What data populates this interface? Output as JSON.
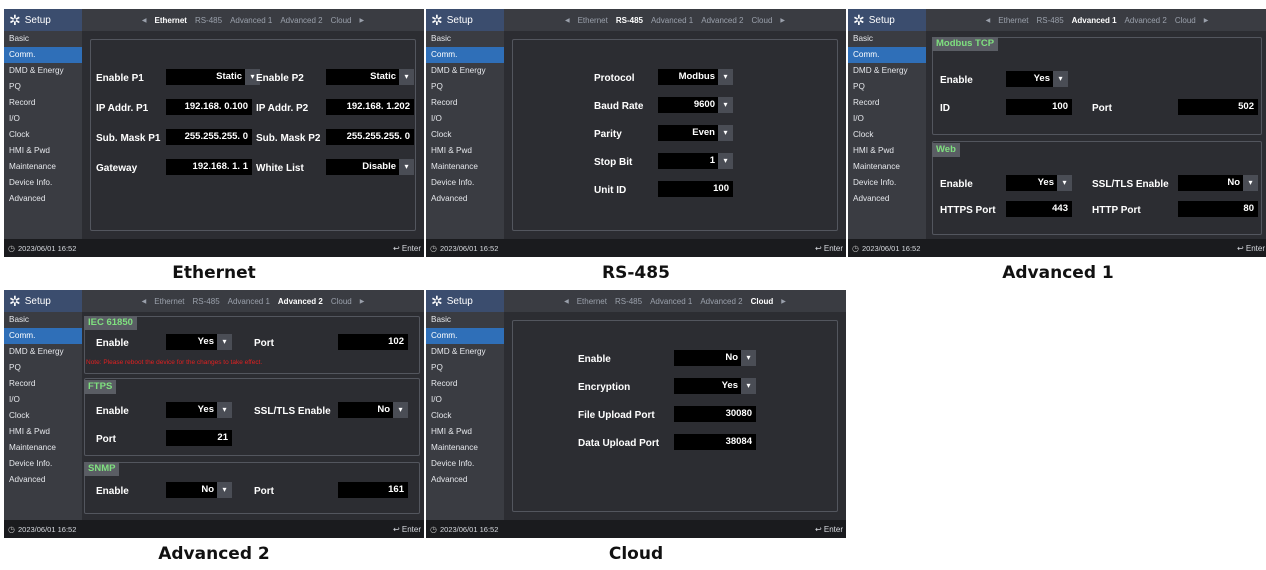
{
  "setup_label": "Setup",
  "tabs": [
    "Ethernet",
    "RS-485",
    "Advanced 1",
    "Advanced 2",
    "Cloud"
  ],
  "sidebar": [
    "Basic",
    "Comm.",
    "DMD & Energy",
    "PQ",
    "Record",
    "I/O",
    "Clock",
    "HMI & Pwd",
    "Maintenance",
    "Device Info.",
    "Advanced"
  ],
  "status": {
    "datetime": "2023/06/01 16:52",
    "enter": "Enter"
  },
  "captions": {
    "ethernet": "Ethernet",
    "rs485": "RS-485",
    "advanced1": "Advanced 1",
    "advanced2": "Advanced 2",
    "cloud": "Cloud"
  },
  "ethernet": {
    "enable_p1": {
      "label": "Enable P1",
      "value": "Static"
    },
    "enable_p2": {
      "label": "Enable P2",
      "value": "Static"
    },
    "ip_p1": {
      "label": "IP Addr. P1",
      "value": "192.168.  0.100"
    },
    "ip_p2": {
      "label": "IP Addr. P2",
      "value": "192.168.  1.202"
    },
    "mask_p1": {
      "label": "Sub. Mask P1",
      "value": "255.255.255.  0"
    },
    "mask_p2": {
      "label": "Sub. Mask P2",
      "value": "255.255.255.  0"
    },
    "gateway": {
      "label": "Gateway",
      "value": "192.168.  1.  1"
    },
    "white_list": {
      "label": "White List",
      "value": "Disable"
    }
  },
  "rs485": {
    "protocol": {
      "label": "Protocol",
      "value": "Modbus"
    },
    "baud": {
      "label": "Baud Rate",
      "value": "9600"
    },
    "parity": {
      "label": "Parity",
      "value": "Even"
    },
    "stop": {
      "label": "Stop Bit",
      "value": "1"
    },
    "unit": {
      "label": "Unit ID",
      "value": "100"
    }
  },
  "advanced1": {
    "modbus_title": "Modbus TCP",
    "mb_enable": {
      "label": "Enable",
      "value": "Yes"
    },
    "mb_id": {
      "label": "ID",
      "value": "100"
    },
    "mb_port": {
      "label": "Port",
      "value": "502"
    },
    "web_title": "Web",
    "web_enable": {
      "label": "Enable",
      "value": "Yes"
    },
    "web_ssl": {
      "label": "SSL/TLS Enable",
      "value": "No"
    },
    "https": {
      "label": "HTTPS Port",
      "value": "443"
    },
    "http": {
      "label": "HTTP Port",
      "value": "80"
    }
  },
  "advanced2": {
    "iec_title": "IEC 61850",
    "iec_enable": {
      "label": "Enable",
      "value": "Yes"
    },
    "iec_port": {
      "label": "Port",
      "value": "102"
    },
    "note": "Note: Please reboot the device for the changes to take effect.",
    "ftps_title": "FTPS",
    "ftps_enable": {
      "label": "Enable",
      "value": "Yes"
    },
    "ftps_ssl": {
      "label": "SSL/TLS Enable",
      "value": "No"
    },
    "ftps_port": {
      "label": "Port",
      "value": "21"
    },
    "snmp_title": "SNMP",
    "snmp_enable": {
      "label": "Enable",
      "value": "No"
    },
    "snmp_port": {
      "label": "Port",
      "value": "161"
    }
  },
  "cloud": {
    "enable": {
      "label": "Enable",
      "value": "No"
    },
    "encryption": {
      "label": "Encryption",
      "value": "Yes"
    },
    "file_port": {
      "label": "File Upload Port",
      "value": "30080"
    },
    "data_port": {
      "label": "Data Upload Port",
      "value": "38084"
    }
  },
  "colors": {
    "active_item": "#2f6fb8",
    "section_title": "#7fe07f",
    "note": "#e02020"
  },
  "icons": {
    "setup": "gear-icon",
    "clock": "clock-icon",
    "enter": "enter-arrow-icon",
    "prev": "left-triangle-icon",
    "next": "right-triangle-icon",
    "dropdown": "dropdown-caret-icon"
  }
}
